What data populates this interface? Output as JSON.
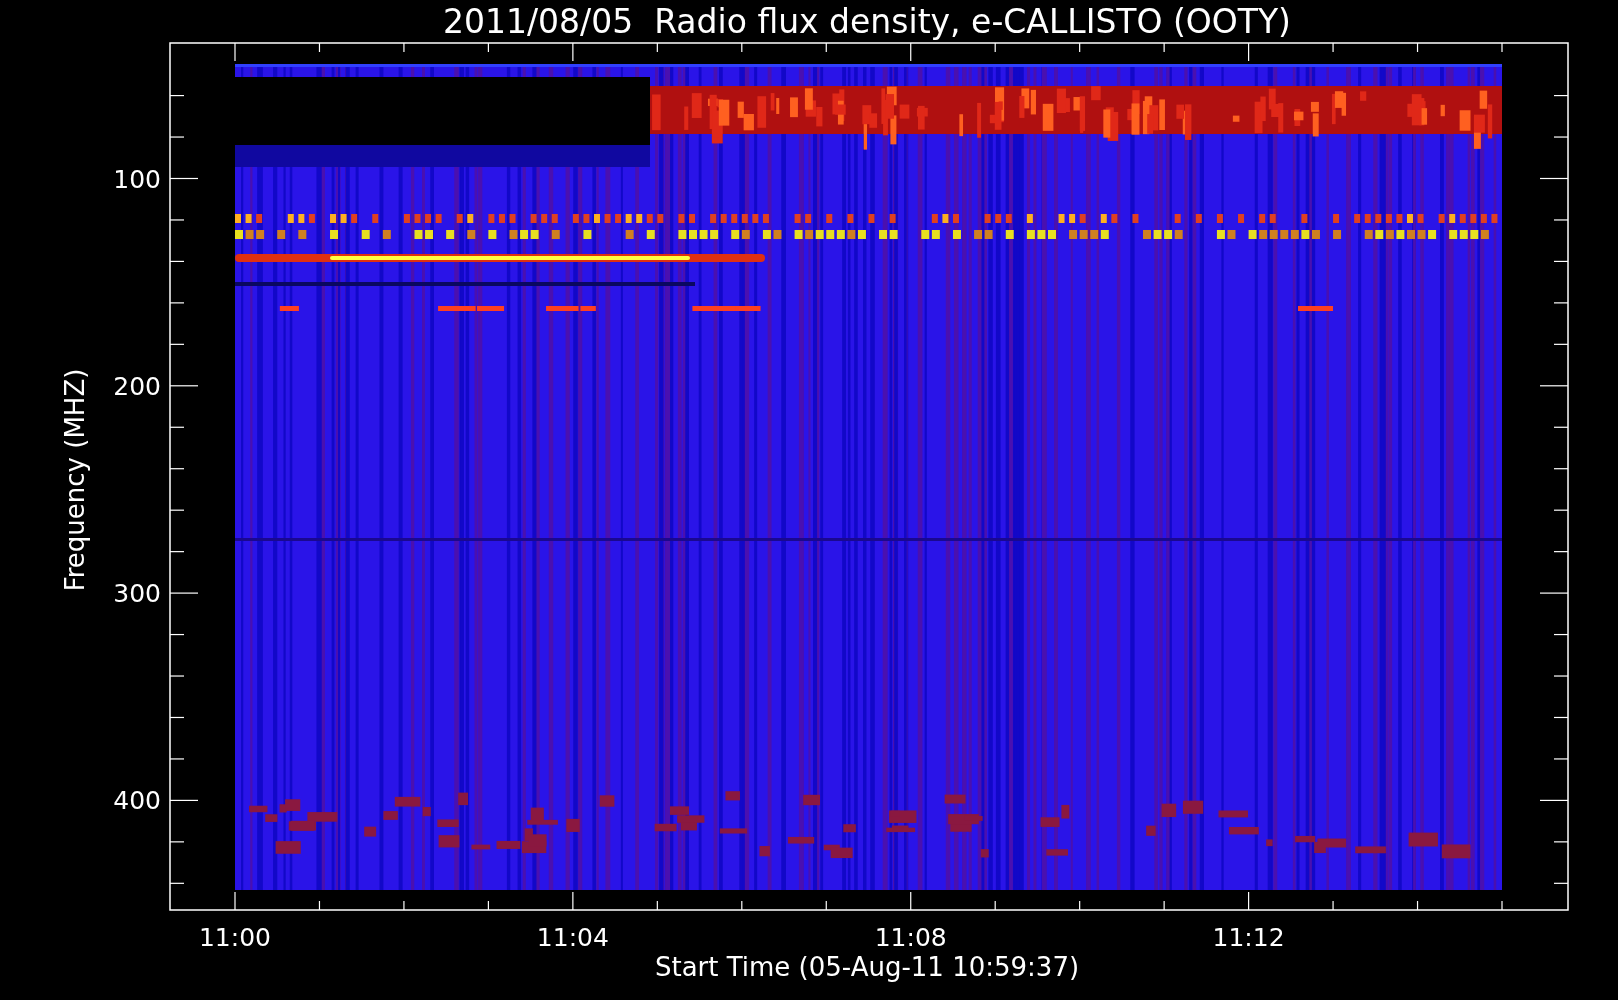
{
  "title": "2011/08/05  Radio flux density, e-CALLISTO (OOTY)",
  "xlabel": "Start Time (05-Aug-11 10:59:37)",
  "ylabel": "Frequency (MHZ)",
  "xticks": [
    "11:00",
    "11:04",
    "11:08",
    "11:12"
  ],
  "yticks": [
    "100",
    "200",
    "300",
    "400"
  ]
}
